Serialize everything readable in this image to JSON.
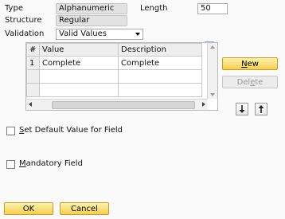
{
  "form": {
    "type_label": "Type",
    "type_value": "Alphanumeric",
    "length_label": "Length",
    "length_value": "50",
    "structure_label": "Structure",
    "structure_value": "Regular",
    "validation_label": "Validation",
    "validation_value": "Valid Values"
  },
  "table": {
    "headers": [
      "#",
      "Value",
      "Description"
    ],
    "rows": [
      {
        "num": "1",
        "value": "Complete",
        "description": "Complete"
      }
    ]
  },
  "buttons": {
    "new_prefix": "",
    "new_mnemonic": "N",
    "new_rest": "ew",
    "delete_prefix": "Del",
    "delete_mnemonic": "e",
    "delete_rest": "te",
    "ok": "OK",
    "cancel": "Cancel"
  },
  "checks": {
    "default_prefix": "",
    "default_mnemonic": "S",
    "default_rest": "et Default Value for Field",
    "default_checked": false,
    "mandatory_prefix": "",
    "mandatory_mnemonic": "M",
    "mandatory_rest": "andatory Field",
    "mandatory_checked": false
  },
  "icons": {
    "expand": "expand-arrow-icon",
    "move_down": "arrow-down-icon",
    "move_up": "arrow-up-icon"
  },
  "colors": {
    "accent_button": "#f6cf4f",
    "expand_icon": "#4a7fc4"
  }
}
